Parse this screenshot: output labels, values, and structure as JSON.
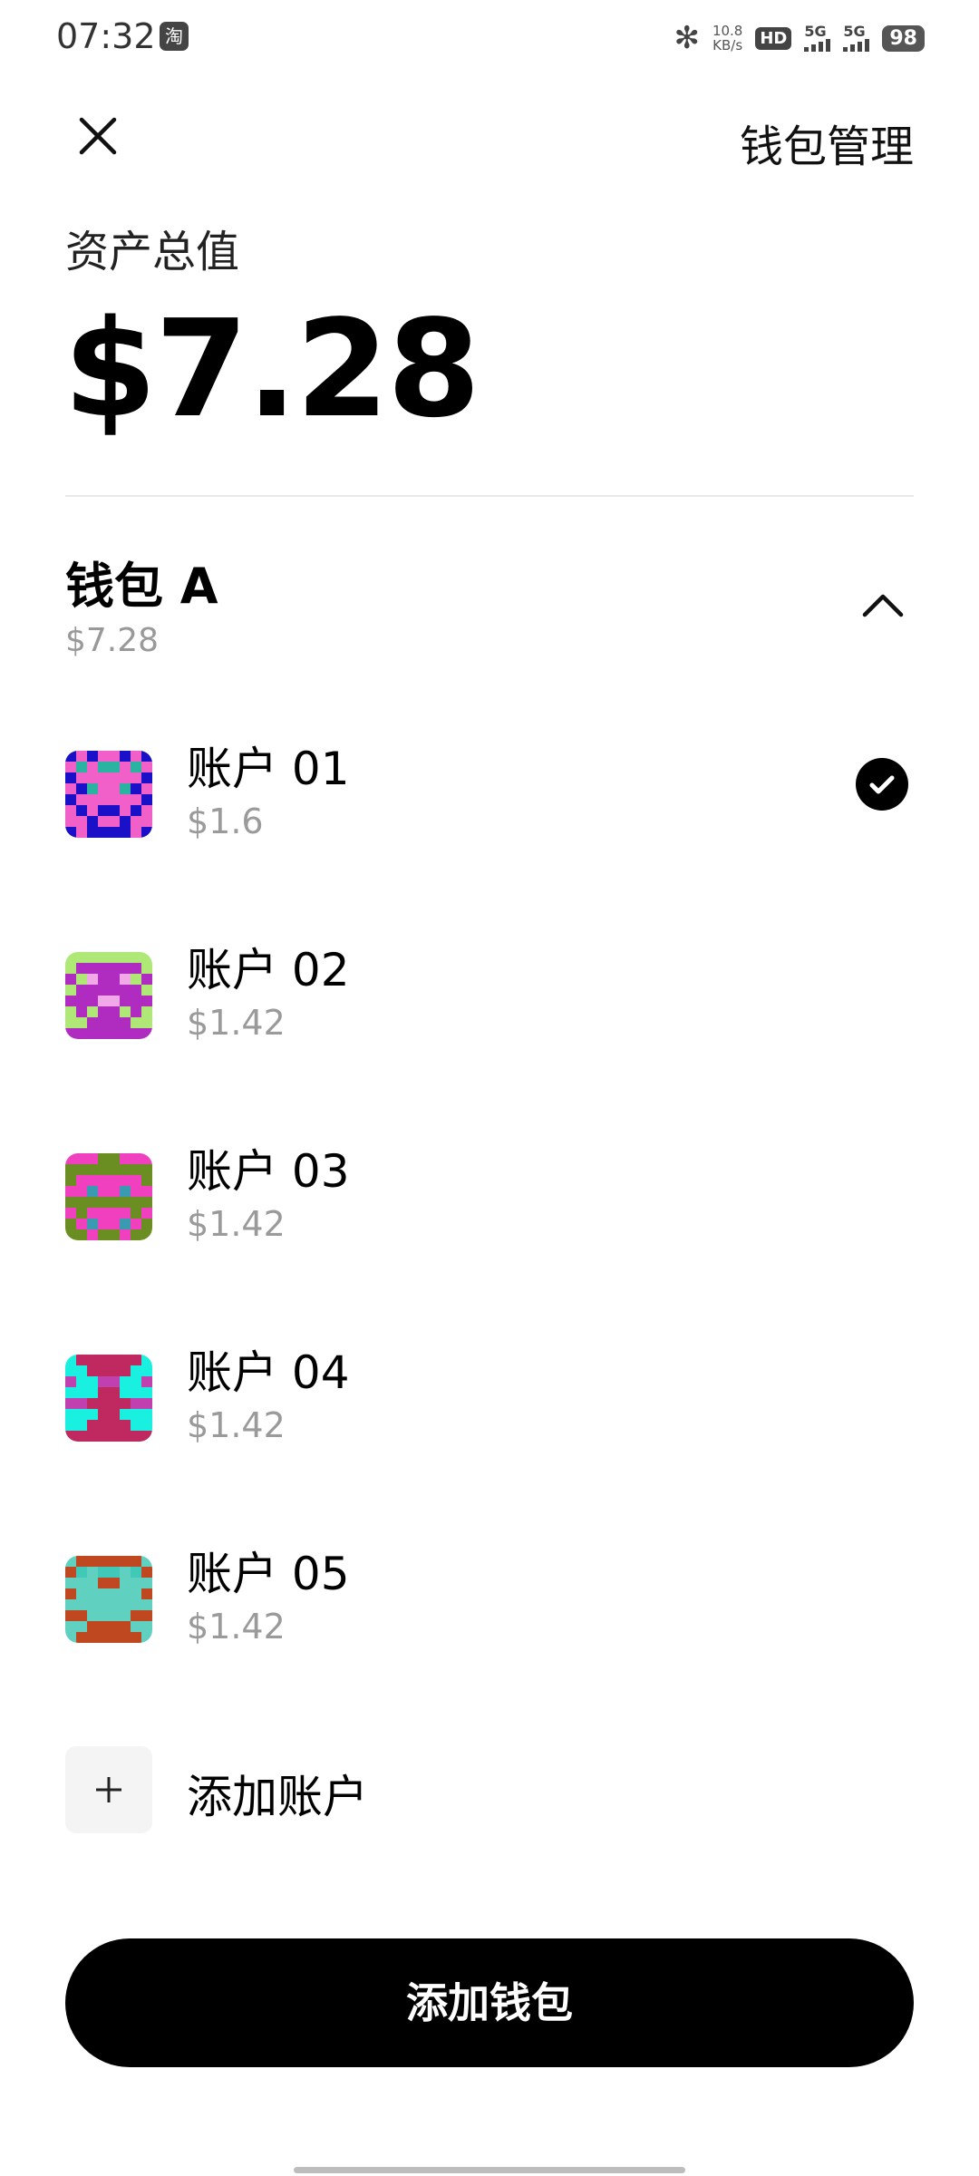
{
  "status_bar": {
    "time": "07:32",
    "app_badge": "淘",
    "net_speed_value": "10.8",
    "net_speed_unit": "KB/s",
    "hd_label": "HD",
    "signal_1": "5G",
    "signal_2": "5G",
    "battery": "98"
  },
  "header": {
    "close_icon": "close-icon",
    "wallet_management": "钱包管理"
  },
  "total": {
    "label": "资产总值",
    "value": "$7.28"
  },
  "wallet": {
    "name": "钱包 A",
    "amount": "$7.28",
    "collapse_icon": "chevron-up-icon"
  },
  "accounts": [
    {
      "name": "账户 01",
      "amount": "$1.6",
      "selected": true,
      "colors": [
        "#1a10c8",
        "#f060c8",
        "#2ab3a0"
      ]
    },
    {
      "name": "账户 02",
      "amount": "$1.42",
      "colors": [
        "#b0e878",
        "#b02cc0",
        "#f0a8e8"
      ]
    },
    {
      "name": "账户 03",
      "amount": "$1.42",
      "colors": [
        "#6b8e23",
        "#f040c0",
        "#3a9ab0"
      ]
    },
    {
      "name": "账户 04",
      "amount": "$1.42",
      "colors": [
        "#1af0e0",
        "#c02860",
        "#c040b0"
      ]
    },
    {
      "name": "账户 05",
      "amount": "$1.42",
      "colors": [
        "#60d0c0",
        "#c04820",
        "#40c8b8"
      ]
    }
  ],
  "add_account": {
    "label": "添加账户",
    "icon": "plus-icon"
  },
  "add_wallet": {
    "label": "添加钱包"
  }
}
